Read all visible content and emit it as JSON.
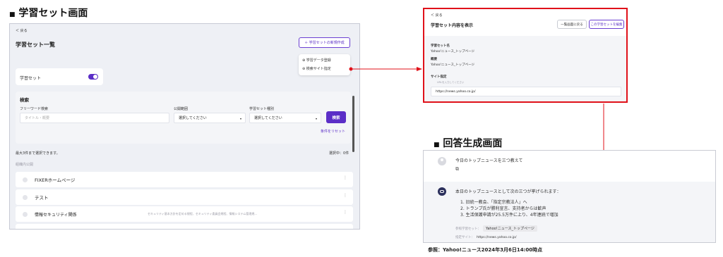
{
  "section_left_title": "学習セット画面",
  "section_answer_title": "回答生成画面",
  "reference_note": "参照：Yahoo!ニュース2024年3月6日14:00時点",
  "left_screen": {
    "back": "＜ 戻る",
    "page_title": "学習セット一覧",
    "new_button": "＋ 学習セットの新規作成",
    "dropdown_items": [
      "学習データ登録",
      "検索サイト指定"
    ],
    "toggle_label": "学習セット",
    "search": {
      "title": "検索",
      "freeword_label": "フリーワード検索",
      "freeword_placeholder": "タイトル・概要",
      "scope_label": "公開範囲",
      "scope_value": "選択してください",
      "type_label": "学習セット種別",
      "type_value": "選択してください",
      "search_button": "検索",
      "reset_link": "条件をリセット"
    },
    "max_note": "最大3件まで選択できます。",
    "selected_count": "選択中：0件",
    "group_label": "組織内公開",
    "rows": [
      {
        "title": "FIXERホームページ",
        "desc": ""
      },
      {
        "title": "テスト",
        "desc": ""
      },
      {
        "title": "情報セキュリティ関係",
        "desc": "セキュリティ基本方針を定める規程、セキュリティ委員会規程、情報システム管理規…"
      }
    ]
  },
  "detail_screen": {
    "back": "＜ 戻る",
    "title": "学習セット内容を表示",
    "back_list_button": "一覧画面に戻る",
    "edit_button": "この学習セットを編集",
    "name_label": "学習セット名",
    "name_value": "Yahoo!ニュース_トップページ",
    "summary_label": "概要",
    "summary_value": "Yahoo!ニュース_トップページ",
    "site_label": "サイト指定",
    "site_hint": "URLを入力してください",
    "site_value": "https://news.yahoo.co.jp/"
  },
  "answer_screen": {
    "question": "今日のトップニュースを三つ教えて",
    "answer_intro": "本日のトップニュースとして次の三つが挙げられます：",
    "answer_items": [
      "1. 旧統一教会、「指定宗教法人」へ",
      "2. トランプ氏が勝利宣言、支持者からは歓声",
      "3. 生活保護申請が25.5万件に上り、4年連続で増加"
    ],
    "ref_set_label": "参照学習セット：",
    "ref_set_value": "Yahoo!ニュース_トップページ",
    "ref_site_label": "指定サイト：",
    "ref_site_value": "https://news.yahoo.co.jp/"
  },
  "colors": {
    "accent": "#5b2ec7",
    "highlight_red": "#e0111a"
  }
}
